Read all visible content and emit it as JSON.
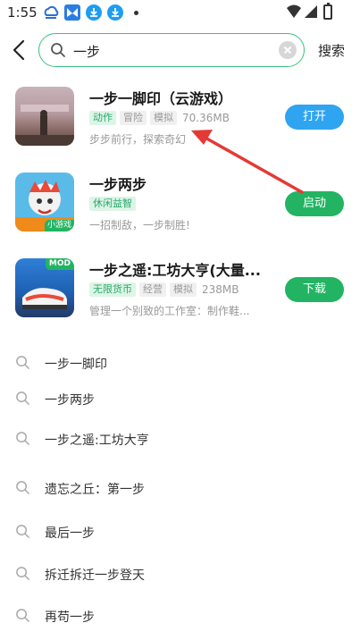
{
  "status_bar": {
    "time": "1:55",
    "icons": [
      "cloud-app-icon",
      "bird-app-icon",
      "download-app-icon",
      "download-app-icon-2"
    ],
    "right_icons": [
      "wifi-icon",
      "signal-icon",
      "battery-icon"
    ]
  },
  "search": {
    "query": "一步",
    "submit_label": "搜索"
  },
  "results": [
    {
      "title": "一步一脚印（云游戏）",
      "tags": [
        "动作",
        "冒险",
        "模拟"
      ],
      "size": "70.36MB",
      "description": "步步前行，探索奇幻",
      "action": "打开",
      "action_color": "#2fa4f0"
    },
    {
      "title": "一步两步",
      "tags": [
        "休闲益智"
      ],
      "size": "",
      "description": "一招制敌，一步制胜!",
      "action": "启动",
      "action_color": "#22b463",
      "badge": "小游戏"
    },
    {
      "title": "一步之遥:工坊大亨(大量...",
      "tags": [
        "无限货币",
        "经营",
        "模拟"
      ],
      "size": "238MB",
      "description": "管理一个别致的工作室：制作鞋...",
      "action": "下载",
      "action_color": "#22b463",
      "badge": "MOD"
    }
  ],
  "suggestions": [
    "一步一脚印",
    "一步两步",
    "一步之遥:工坊大亨",
    "遗忘之丘：第一步",
    "最后一步",
    "拆迁拆迁一步登天",
    "再苟一步"
  ],
  "colors": {
    "accent_green": "#37c37e",
    "tag_green_bg": "#dcf5e7",
    "annotation_red": "#e53935"
  }
}
